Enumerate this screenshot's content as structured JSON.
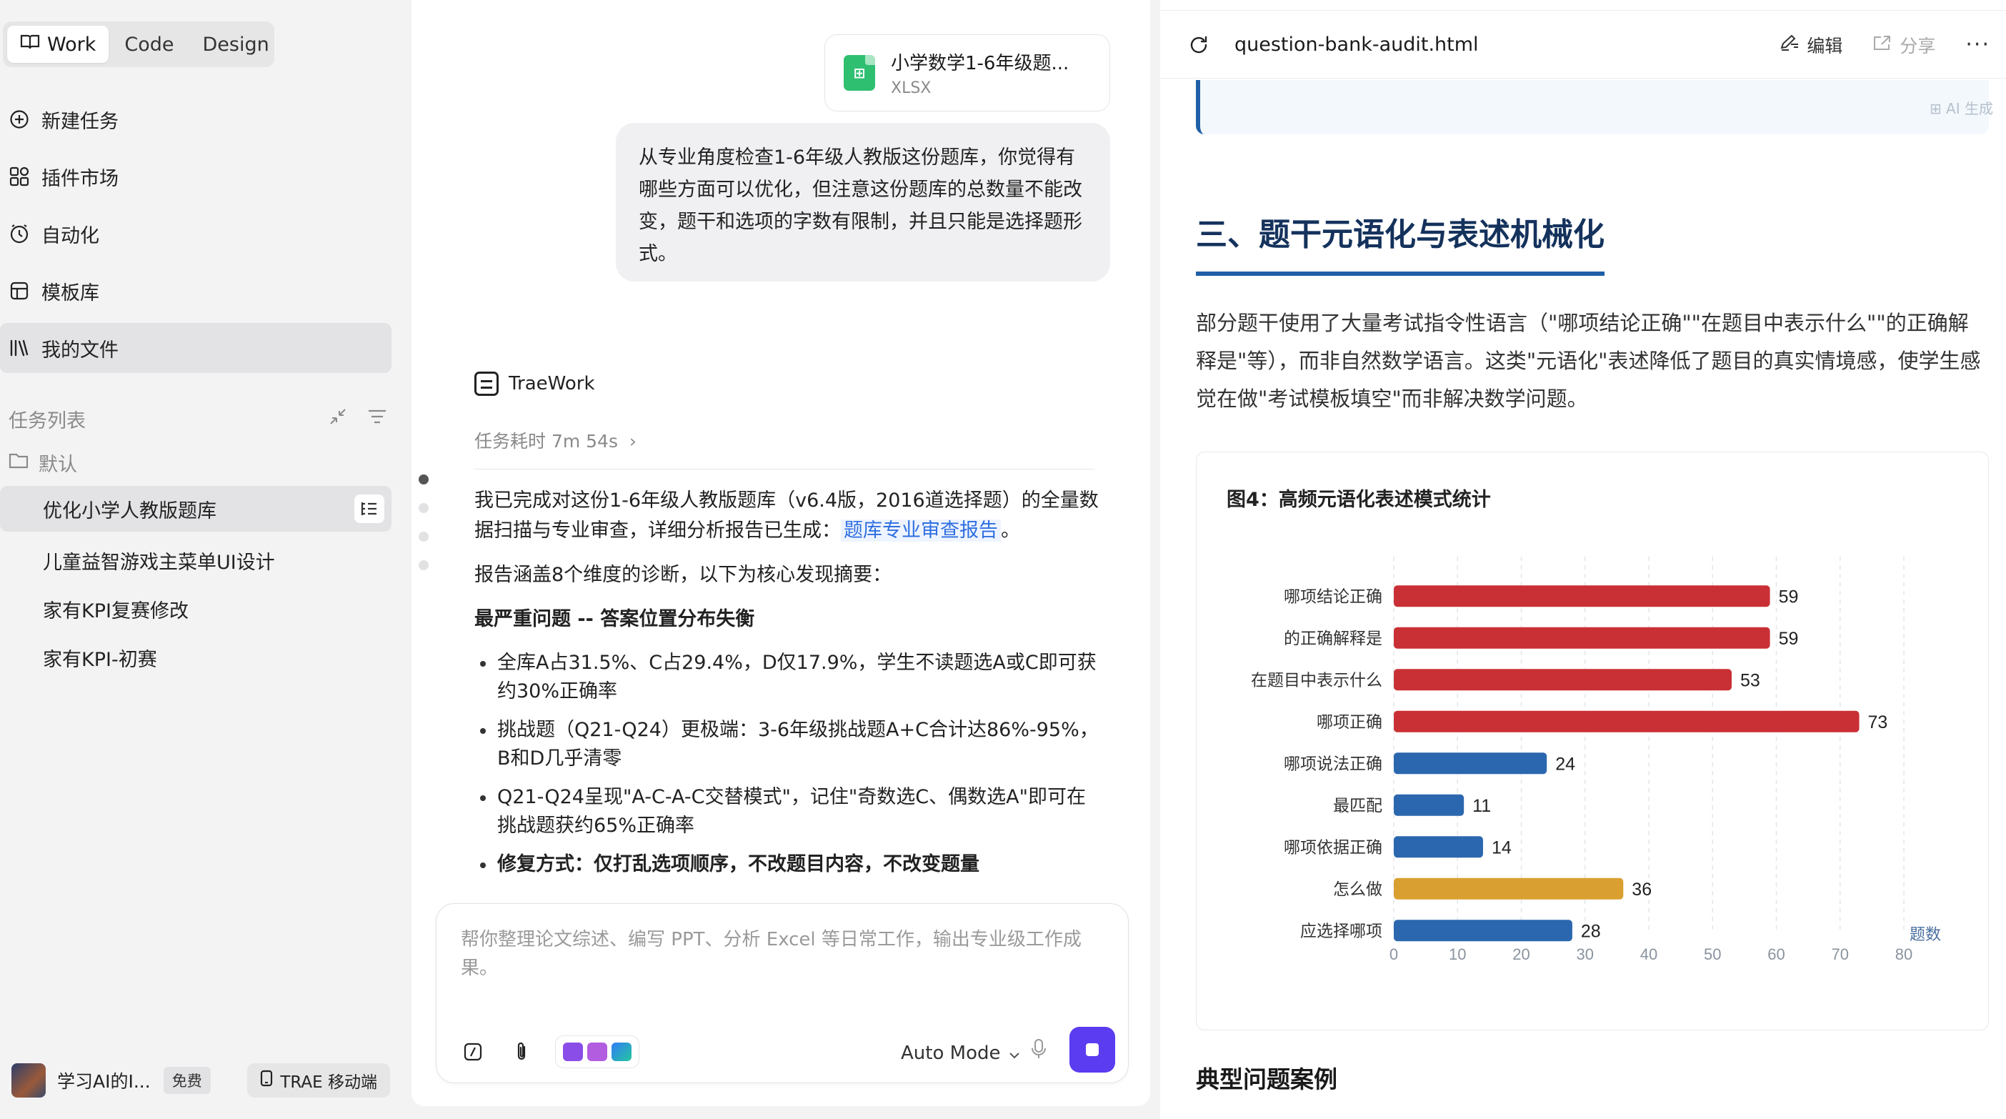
{
  "sidebar": {
    "modes": [
      "Work",
      "Code",
      "Design"
    ],
    "nav": [
      {
        "label": "新建任务",
        "icon": "new-task-icon"
      },
      {
        "label": "插件市场",
        "icon": "plugin-icon"
      },
      {
        "label": "自动化",
        "icon": "clock-icon"
      },
      {
        "label": "模板库",
        "icon": "template-icon"
      },
      {
        "label": "我的文件",
        "icon": "files-icon"
      }
    ],
    "task_section": "任务列表",
    "folder": "默认",
    "tasks": [
      "优化小学人教版题库",
      "儿童益智游戏主菜单UI设计",
      "家有KPI复赛修改",
      "家有KPI-初赛"
    ],
    "user": {
      "name": "学习AI的I...",
      "badge": "免费",
      "mobile": "TRAE 移动端"
    }
  },
  "chat": {
    "file": {
      "name": "小学数学1-6年级题...",
      "type": "XLSX"
    },
    "user_message": "从专业角度检查1-6年级人教版这份题库，你觉得有哪些方面可以优化，但注意这份题库的总数量不能改变，题干和选项的字数有限制，并且只能是选择题形式。",
    "agent": "TraeWork",
    "elapsed": "任务耗时 7m 54s",
    "answer": {
      "p1_before": "我已完成对这份1-6年级人教版题库（v6.4版，2016道选择题）的全量数据扫描与专业审查，详细分析报告已生成：",
      "p1_link": "题库专业审查报告",
      "p1_after": "。",
      "p2": "报告涵盖8个维度的诊断，以下为核心发现摘要：",
      "heading": "最严重问题 -- 答案位置分布失衡",
      "bullets": [
        "全库A占31.5%、C占29.4%，D仅17.9%，学生不读题选A或C即可获约30%正确率",
        "挑战题（Q21-Q24）更极端：3-6年级挑战题A+C合计达86%-95%，B和D几乎清零",
        "Q21-Q24呈现\"A-C-A-C交替模式\"，记住\"奇数选C、偶数选A\"即可在挑战题获约65%正确率",
        "修复方式：仅打乱选项顺序，不改题目内容，不改变题量"
      ]
    },
    "composer": {
      "placeholder": "帮你整理论文综述、编写 PPT、分析 Excel 等日常工作，输出专业级工作成果。",
      "mode": "Auto Mode"
    }
  },
  "preview": {
    "filename": "question-bank-audit.html",
    "edit": "编辑",
    "share": "分享",
    "callout_tag": "⊞ AI 生成",
    "section_title": "三、题干元语化与表述机械化",
    "paragraph": "部分题干使用了大量考试指令性语言（\"哪项结论正确\"\"在题目中表示什么\"\"的正确解释是\"等），而非自然数学语言。这类\"元语化\"表述降低了题目的真实情境感，使学生感觉在做\"考试模板填空\"而非解决数学问题。",
    "next_heading": "典型问题案例"
  },
  "chart_data": {
    "type": "bar",
    "orientation": "horizontal",
    "title": "图4：高频元语化表述模式统计",
    "xlabel": "题数",
    "ylabel": "",
    "categories": [
      "哪项结论正确",
      "的正确解释是",
      "在题目中表示什么",
      "哪项正确",
      "哪项说法正确",
      "最匹配",
      "哪项依据正确",
      "怎么做",
      "应选择哪项"
    ],
    "values": [
      59,
      59,
      53,
      73,
      24,
      11,
      14,
      36,
      28
    ],
    "colors": [
      "#c93035",
      "#c93035",
      "#c93035",
      "#c93035",
      "#2b67ae",
      "#2b67ae",
      "#2b67ae",
      "#d9a031",
      "#2b67ae"
    ],
    "xlim": [
      0,
      80
    ],
    "xticks": [
      0,
      10,
      20,
      30,
      40,
      50,
      60,
      70,
      80
    ],
    "grid": true
  }
}
